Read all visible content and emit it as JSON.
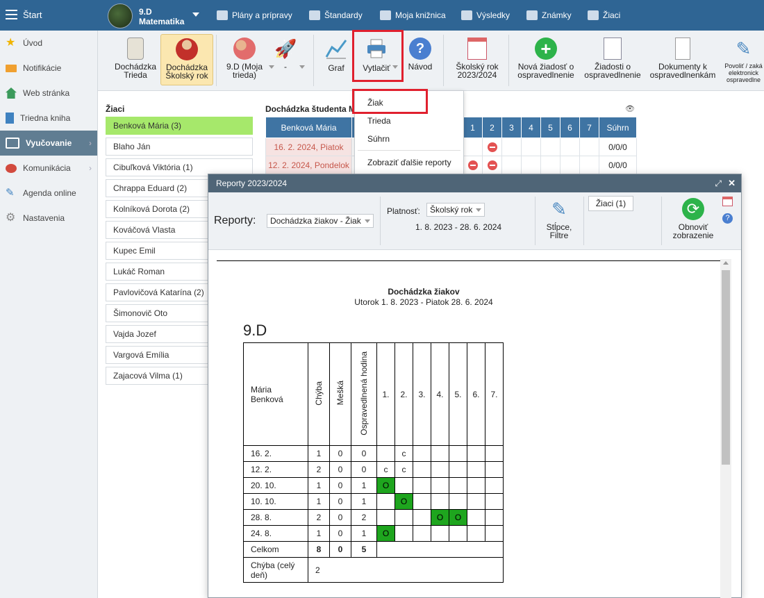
{
  "topbar": {
    "start": "Štart",
    "class_name": "9.D",
    "class_subject": "Matematika",
    "nav": [
      "Plány a prípravy",
      "Štandardy",
      "Moja knižnica",
      "Výsledky",
      "Známky",
      "Žiaci"
    ]
  },
  "sidebar": {
    "items": [
      {
        "label": "Úvod"
      },
      {
        "label": "Notifikácie"
      },
      {
        "label": "Web stránka"
      },
      {
        "label": "Triedna kniha"
      },
      {
        "label": "Vyučovanie"
      },
      {
        "label": "Komunikácia"
      },
      {
        "label": "Agenda online"
      },
      {
        "label": "Nastavenia"
      }
    ]
  },
  "toolbar": {
    "dochadzka_trieda": [
      "Dochádzka",
      "Trieda"
    ],
    "dochadzka_rok": [
      "Dochádzka",
      "Školský rok"
    ],
    "moja_trieda": [
      "9.D (Moja",
      "trieda)"
    ],
    "dash": "-",
    "graf": "Graf",
    "vytlacit": "Vytlačiť",
    "navod": "Návod",
    "skolsky_rok": [
      "Školský rok",
      "2023/2024"
    ],
    "nova_ziadost": [
      "Nová žiadosť o",
      "ospravedlnenie"
    ],
    "ziadosti": [
      "Žiadosti o",
      "ospravedlnenie"
    ],
    "dokumenty": [
      "Dokumenty k",
      "ospravedlnenkám"
    ],
    "povolit": [
      "Povoliť / zaká",
      "elektronick",
      "ospravedlne"
    ]
  },
  "students": {
    "header": "Žiaci",
    "list": [
      "Benková Mária (3)",
      "Blaho Ján",
      "Cibuľková Viktória (1)",
      "Chrappa Eduard (2)",
      "Kolníková Dorota (2)",
      "Kováčová Vlasta",
      "Kupec Emil",
      "Lukáč Roman",
      "Pavlovičová Katarína (2)",
      "Šimonovič Oto",
      "Vajda Jozef",
      "Vargová Emília",
      "Zajacová Vilma (1)"
    ]
  },
  "attendance": {
    "header": "Dochádzka študenta M",
    "col_name": "Benková Mária",
    "cols": [
      "1",
      "2",
      "3",
      "4",
      "5",
      "6",
      "7"
    ],
    "col_sum": "Súhrn",
    "rows": [
      {
        "date": "16. 2. 2024, Piatok",
        "sum": "0/0/0"
      },
      {
        "date": "12. 2. 2024, Pondelok",
        "sum": "0/0/0"
      }
    ]
  },
  "dropdown": {
    "items": [
      "Žiak",
      "Trieda",
      "Súhrn",
      "Zobraziť ďalšie reporty"
    ]
  },
  "dialog": {
    "title": "Reporty 2023/2024",
    "reporty_label": "Reporty:",
    "reporty_value": "Dochádzka žiakov - Žiak",
    "platnost_label": "Platnosť:",
    "platnost_value": "Školský rok",
    "date_range": "1. 8. 2023 - 28. 6. 2024",
    "stlpce": [
      "Stĺpce,",
      "Filtre"
    ],
    "ziaci": "Žiaci (1)",
    "obnovit": [
      "Obnoviť",
      "zobrazenie"
    ]
  },
  "report": {
    "title": "Dochádzka žiakov",
    "subtitle": "Utorok 1. 8. 2023 - Piatok 28. 6. 2024",
    "class": "9.D",
    "student": [
      "Mária",
      "Benková"
    ],
    "h_chyba": "Chýba",
    "h_meska": "Mešká",
    "h_ospr": "Ospravedlnená hodina",
    "lessons": [
      "1.",
      "2.",
      "3.",
      "4.",
      "5.",
      "6.",
      "7."
    ],
    "rows": [
      {
        "date": "16. 2.",
        "chyba": "1",
        "meska": "0",
        "ospr": "0",
        "cells": [
          "",
          "c",
          "",
          "",
          "",
          "",
          ""
        ]
      },
      {
        "date": "12. 2.",
        "chyba": "2",
        "meska": "0",
        "ospr": "0",
        "cells": [
          "c",
          "c",
          "",
          "",
          "",
          "",
          ""
        ]
      },
      {
        "date": "20. 10.",
        "chyba": "1",
        "meska": "0",
        "ospr": "1",
        "cells": [
          "O",
          "",
          "",
          "",
          "",
          "",
          ""
        ]
      },
      {
        "date": "10. 10.",
        "chyba": "1",
        "meska": "0",
        "ospr": "1",
        "cells": [
          "",
          "O",
          "",
          "",
          "",
          "",
          ""
        ]
      },
      {
        "date": "28. 8.",
        "chyba": "2",
        "meska": "0",
        "ospr": "2",
        "cells": [
          "",
          "",
          "",
          "O",
          "O",
          "",
          ""
        ]
      },
      {
        "date": "24. 8.",
        "chyba": "1",
        "meska": "0",
        "ospr": "1",
        "cells": [
          "O",
          "",
          "",
          "",
          "",
          "",
          ""
        ]
      }
    ],
    "total_label": "Celkom",
    "total": [
      "8",
      "0",
      "5"
    ],
    "full_day_label": "Chýba (celý deň)",
    "full_day": "2"
  },
  "colors": {
    "topbar": "#2f6594",
    "active_student": "#a6e86b",
    "excused": "#1ea51e",
    "highlight": "#e0202e"
  }
}
